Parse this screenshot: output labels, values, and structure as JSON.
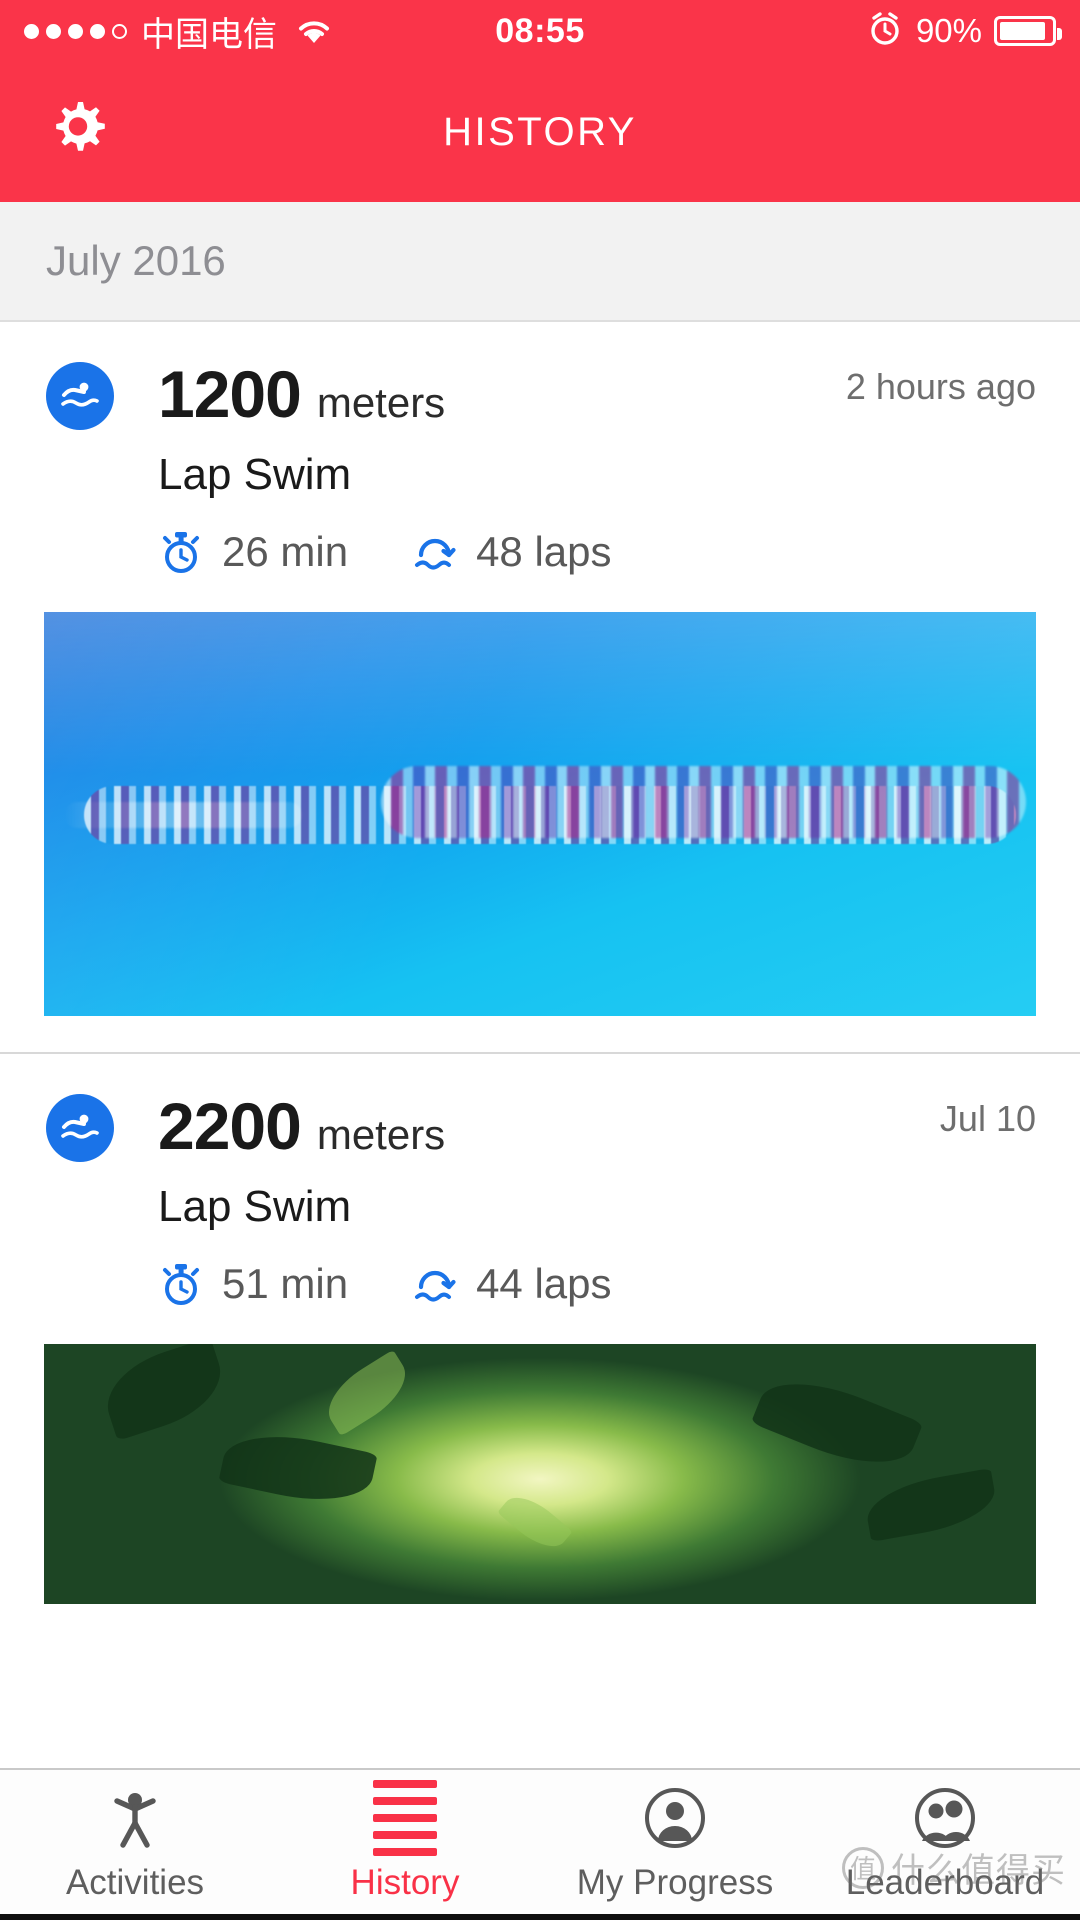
{
  "status_bar": {
    "signal_dots_filled": 4,
    "signal_dots_total": 5,
    "carrier": "中国电信",
    "wifi_icon": "wifi-icon",
    "time": "08:55",
    "alarm_icon": "alarm-icon",
    "battery_percent": "90%",
    "battery_level": 90
  },
  "header": {
    "settings_icon": "gear-icon",
    "title": "HISTORY",
    "background_color": "#FA3449"
  },
  "section": {
    "month_label": "July 2016"
  },
  "activities": [
    {
      "sport_icon": "swimmer-icon",
      "distance_value": "1200",
      "distance_unit": "meters",
      "activity_type": "Lap Swim",
      "timestamp": "2 hours ago",
      "stats": [
        {
          "icon": "stopwatch-icon",
          "text": "26 min"
        },
        {
          "icon": "laps-icon",
          "text": "48 laps"
        }
      ],
      "photo": "swimming-pool-photo"
    },
    {
      "sport_icon": "swimmer-icon",
      "distance_value": "2200",
      "distance_unit": "meters",
      "activity_type": "Lap Swim",
      "timestamp": "Jul 10",
      "stats": [
        {
          "icon": "stopwatch-icon",
          "text": "51 min"
        },
        {
          "icon": "laps-icon",
          "text": "44 laps"
        }
      ],
      "photo": "green-forest-photo"
    }
  ],
  "tabbar": {
    "items": [
      {
        "icon": "activities-person-icon",
        "label": "Activities",
        "active": false
      },
      {
        "icon": "history-lines-icon",
        "label": "History",
        "active": true
      },
      {
        "icon": "my-progress-person-icon",
        "label": "My Progress",
        "active": false
      },
      {
        "icon": "leaderboard-people-icon",
        "label": "Leaderboard",
        "active": false
      }
    ],
    "active_color": "#F93147",
    "inactive_color": "#5E5E5E"
  },
  "watermark": {
    "text": "什么值得买",
    "mark": "值"
  },
  "colors": {
    "brand_red": "#FA3449",
    "accent_blue": "#1A73E8",
    "section_gray": "#F2F2F2"
  }
}
